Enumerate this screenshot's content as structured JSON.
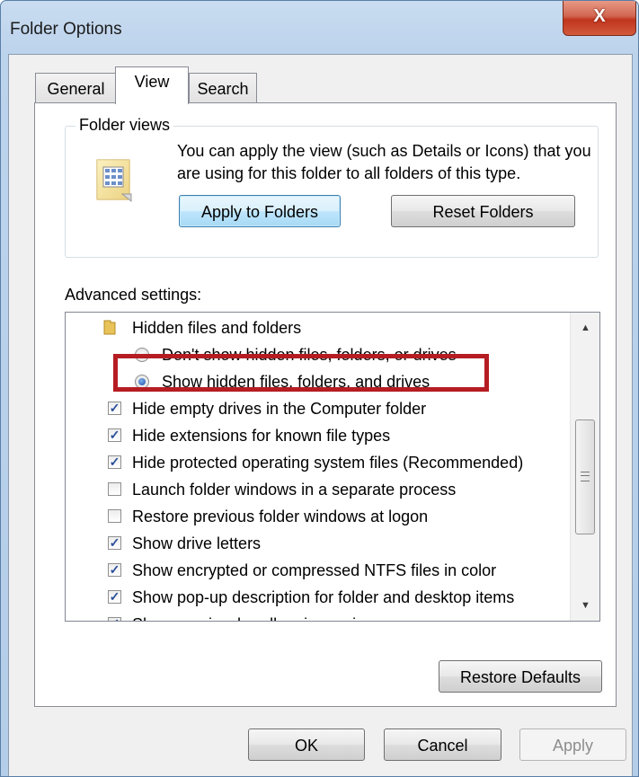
{
  "window": {
    "title": "Folder Options",
    "close_glyph": "X"
  },
  "tabs": [
    {
      "label": "General",
      "active": false
    },
    {
      "label": "View",
      "active": true
    },
    {
      "label": "Search",
      "active": false
    }
  ],
  "folder_views": {
    "group_label": "Folder views",
    "description": "You can apply the view (such as Details or Icons) that you are using for this folder to all folders of this type.",
    "apply_button": "Apply to Folders",
    "reset_button": "Reset Folders"
  },
  "advanced": {
    "label": "Advanced settings:",
    "items": [
      {
        "type": "folder",
        "label": "Hidden files and folders"
      },
      {
        "type": "radio",
        "label": "Don't show hidden files, folders, or drives",
        "checked": false
      },
      {
        "type": "radio",
        "label": "Show hidden files, folders, and drives",
        "checked": true
      },
      {
        "type": "checkbox",
        "label": "Hide empty drives in the Computer folder",
        "checked": true
      },
      {
        "type": "checkbox",
        "label": "Hide extensions for known file types",
        "checked": true
      },
      {
        "type": "checkbox",
        "label": "Hide protected operating system files (Recommended)",
        "checked": true
      },
      {
        "type": "checkbox",
        "label": "Launch folder windows in a separate process",
        "checked": false
      },
      {
        "type": "checkbox",
        "label": "Restore previous folder windows at logon",
        "checked": false
      },
      {
        "type": "checkbox",
        "label": "Show drive letters",
        "checked": true
      },
      {
        "type": "checkbox",
        "label": "Show encrypted or compressed NTFS files in color",
        "checked": true
      },
      {
        "type": "checkbox",
        "label": "Show pop-up description for folder and desktop items",
        "checked": true
      },
      {
        "type": "checkbox",
        "label": "Show preview handlers in preview pane",
        "checked": true
      }
    ],
    "restore_defaults": "Restore Defaults"
  },
  "footer": {
    "ok": "OK",
    "cancel": "Cancel",
    "apply": "Apply"
  },
  "colors": {
    "highlight": "#b51d23",
    "titlebar": "#bcd3ec",
    "close": "#c0341d"
  },
  "icons": {
    "close": "close-icon",
    "folder_views": "folder-views-icon",
    "folder": "folder-icon"
  }
}
